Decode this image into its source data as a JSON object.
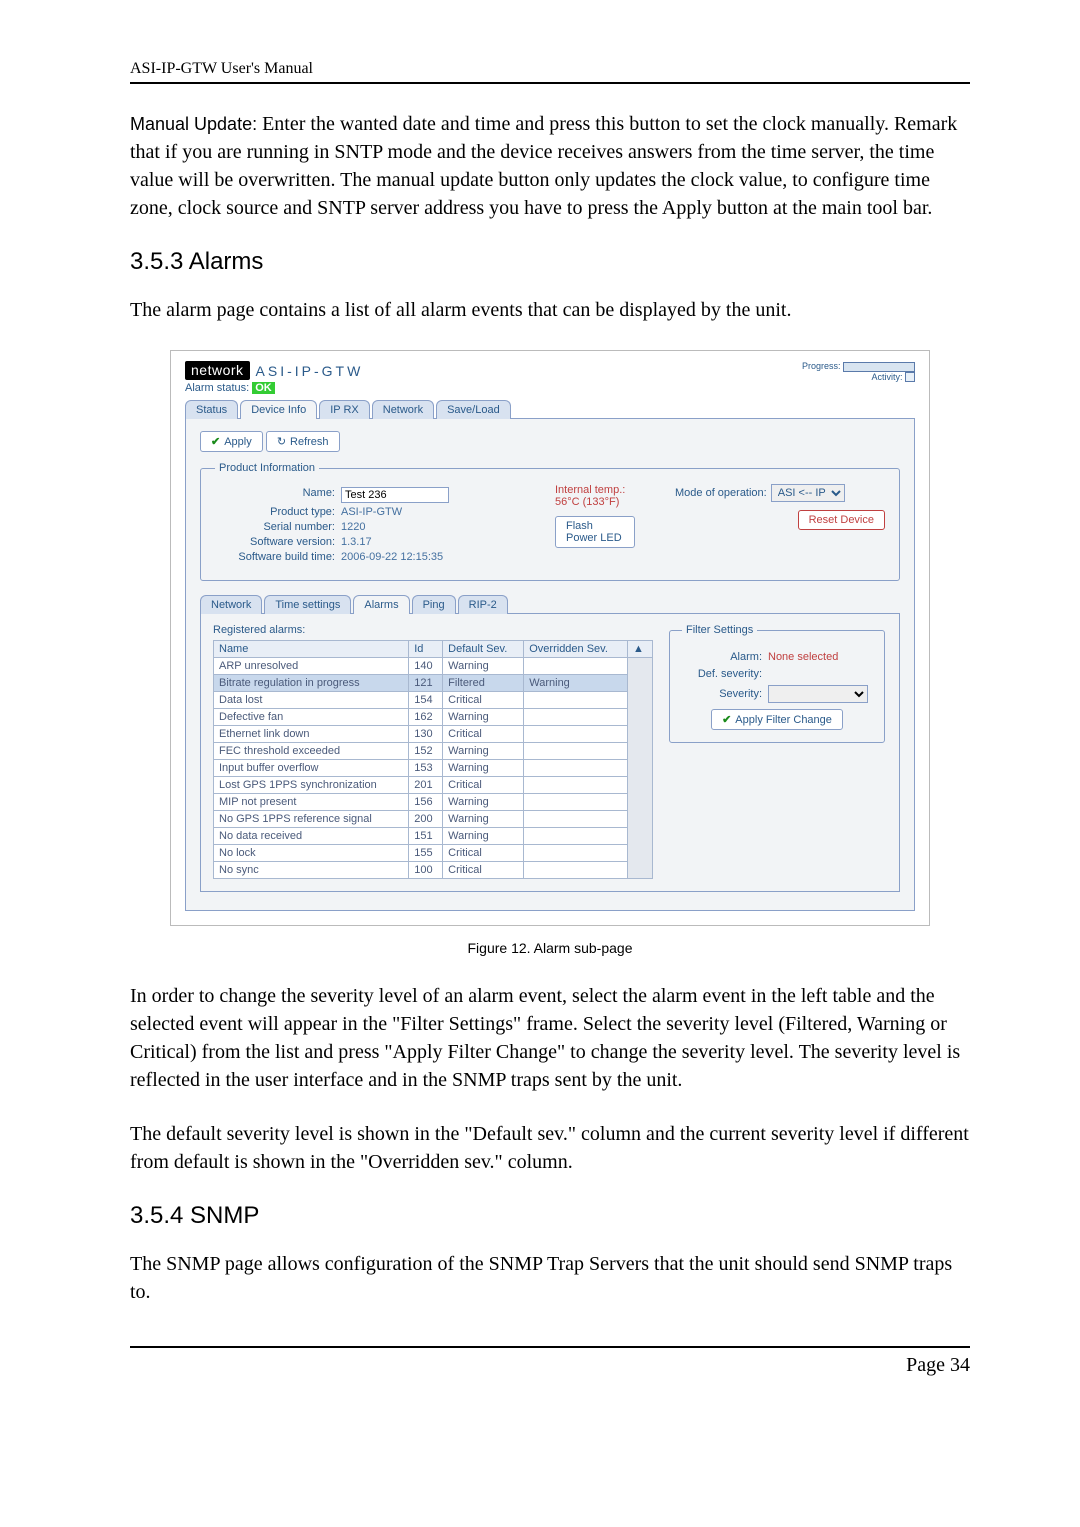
{
  "doc": {
    "header": "ASI-IP-GTW User's Manual",
    "manual_update_lead": "Manual Update:",
    "manual_update_text": " Enter the wanted date and time and press this button to set the clock manually. Remark that if you are running in SNTP mode and the device receives answers from the time server, the time value will be overwritten. The manual update button only updates the clock value, to configure time zone, clock source and SNTP server address you have to press the Apply button at the main tool bar.",
    "sec_alarms": "3.5.3 Alarms",
    "alarms_intro": "The alarm page contains a list of all alarm events that can be displayed by the unit.",
    "fig_caption": "Figure 12. Alarm sub-page",
    "para1": "In order to change the severity level of an alarm event, select the alarm event in the left table and the selected event will appear in the \"Filter Settings\" frame. Select the severity level (Filtered, Warning or Critical) from the list and press \"Apply Filter Change\" to change the severity level. The severity level is reflected in the user interface and in the SNMP traps sent by the unit.",
    "para2": "The default severity level is shown in the \"Default sev.\" column and the current severity level if different from default is shown in the \"Overridden sev.\" column.",
    "sec_snmp": "3.5.4 SNMP",
    "snmp_intro": "The SNMP page allows configuration of the SNMP Trap Servers that the unit should send SNMP traps to.",
    "footer": "Page 34"
  },
  "shot": {
    "logo": "network",
    "app_title": "ASI-IP-GTW",
    "progress_label": "Progress:",
    "activity_label": "Activity:",
    "alarm_status_label": "Alarm status:",
    "alarm_status_value": "OK",
    "outer_tabs": [
      "Status",
      "Device Info",
      "IP RX",
      "Network",
      "Save/Load"
    ],
    "apply_btn": "Apply",
    "refresh_btn": "Refresh",
    "pinfo_legend": "Product Information",
    "pinfo_name_label": "Name:",
    "pinfo_name_value": "Test 236",
    "pinfo_type_label": "Product type:",
    "pinfo_type_value": "ASI-IP-GTW",
    "pinfo_serial_label": "Serial number:",
    "pinfo_serial_value": "1220",
    "pinfo_sw_label": "Software version:",
    "pinfo_sw_value": "1.3.17",
    "pinfo_build_label": "Software build time:",
    "pinfo_build_value": "2006-09-22 12:15:35",
    "internal_temp": "Internal temp.: 56°C (133°F)",
    "flash_power_led": "Flash Power LED",
    "mode_label": "Mode of operation:",
    "mode_value": "ASI <-- IP",
    "reset_device": "Reset Device",
    "inner_tabs": [
      "Network",
      "Time settings",
      "Alarms",
      "Ping",
      "RIP-2"
    ],
    "reg_alarms_label": "Registered alarms:",
    "th_name": "Name",
    "th_id": "Id",
    "th_default": "Default Sev.",
    "th_override": "Overridden Sev.",
    "rows": [
      {
        "name": "ARP unresolved",
        "id": "140",
        "def": "Warning",
        "ov": ""
      },
      {
        "name": "Bitrate regulation in progress",
        "id": "121",
        "def": "Filtered",
        "ov": "Warning"
      },
      {
        "name": "Data lost",
        "id": "154",
        "def": "Critical",
        "ov": ""
      },
      {
        "name": "Defective fan",
        "id": "162",
        "def": "Warning",
        "ov": ""
      },
      {
        "name": "Ethernet link down",
        "id": "130",
        "def": "Critical",
        "ov": ""
      },
      {
        "name": "FEC threshold exceeded",
        "id": "152",
        "def": "Warning",
        "ov": ""
      },
      {
        "name": "Input buffer overflow",
        "id": "153",
        "def": "Warning",
        "ov": ""
      },
      {
        "name": "Lost GPS 1PPS synchronization",
        "id": "201",
        "def": "Critical",
        "ov": ""
      },
      {
        "name": "MIP not present",
        "id": "156",
        "def": "Warning",
        "ov": ""
      },
      {
        "name": "No GPS 1PPS reference signal",
        "id": "200",
        "def": "Warning",
        "ov": ""
      },
      {
        "name": "No data received",
        "id": "151",
        "def": "Warning",
        "ov": ""
      },
      {
        "name": "No lock",
        "id": "155",
        "def": "Critical",
        "ov": ""
      },
      {
        "name": "No sync",
        "id": "100",
        "def": "Critical",
        "ov": ""
      }
    ],
    "filter_legend": "Filter Settings",
    "filter_alarm_label": "Alarm:",
    "filter_alarm_value": "None selected",
    "filter_def_label": "Def. severity:",
    "filter_sev_label": "Severity:",
    "apply_filter": "Apply Filter Change"
  }
}
